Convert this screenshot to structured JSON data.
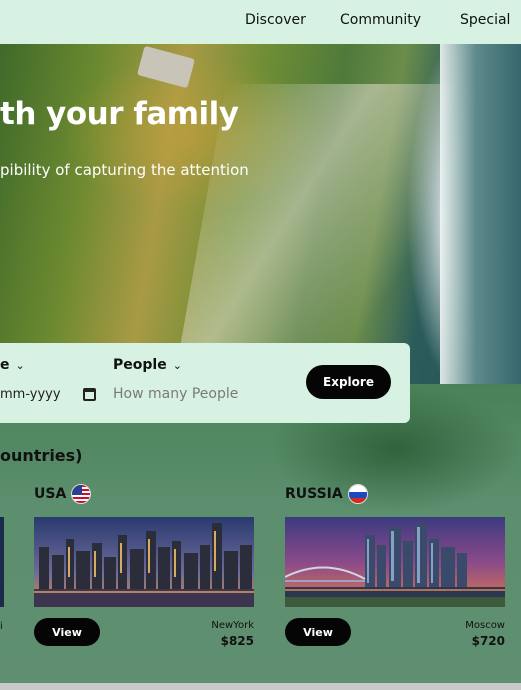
{
  "nav": {
    "items": [
      "Discover",
      "Community",
      "Special"
    ]
  },
  "hero": {
    "title": "th your family",
    "subtitle": "pibility of capturing the attention"
  },
  "search": {
    "date_label": "e",
    "date_value": "mm-yyyy",
    "people_label": "People",
    "people_placeholder": "How many People",
    "explore_label": "Explore"
  },
  "section": {
    "title": "ountries)"
  },
  "cards": [
    {
      "country": "USA",
      "flag_icon": "us-flag-icon",
      "city": "NewYork",
      "price": "$825",
      "view_label": "View"
    },
    {
      "country": "RUSSIA",
      "flag_icon": "russia-flag-icon",
      "city": "Moscow",
      "price": "$720",
      "view_label": "View"
    }
  ],
  "prev_card": {
    "text": "i"
  },
  "colors": {
    "nav_bg": "#d7f2e3",
    "panel_bg": "#d7f2e3",
    "button_bg": "#050505",
    "page_green": "#5b8c6e"
  }
}
